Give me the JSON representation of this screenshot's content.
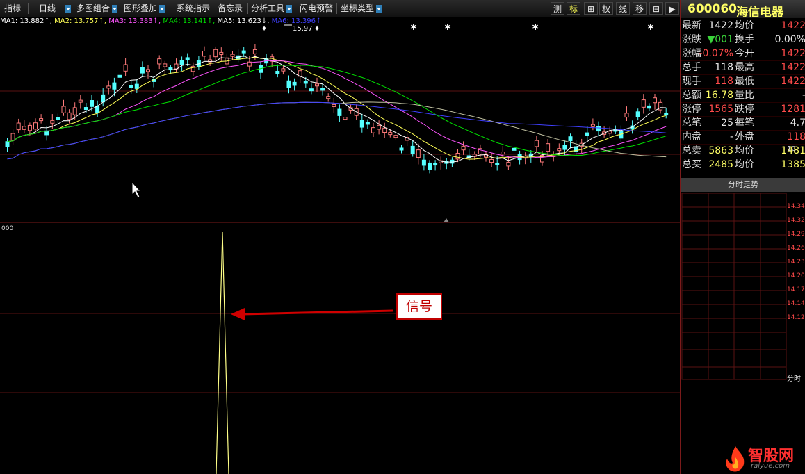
{
  "toolbar": {
    "items": [
      "指标",
      "日线",
      "多图组合",
      "图形叠加",
      "系统指示",
      "备忘录",
      "分析工具",
      "闪电预警",
      "坐标类型"
    ],
    "right_buttons": [
      "测",
      "标",
      "⊞",
      "权",
      "线",
      "移",
      "⊟",
      "▶"
    ]
  },
  "ma": {
    "ma1": "MA1: 13.882",
    "ma2": "MA2: 13.757",
    "ma3": "MA3: 13.383",
    "ma4": "MA4: 13.141",
    "ma5": "MA5: 13.623",
    "ma6": "MA6: 13.396",
    "peak": "15.97"
  },
  "indicator": {
    "label": "000"
  },
  "callout": {
    "text": "信号"
  },
  "stock": {
    "code": "600060",
    "name": "海信电器"
  },
  "quote": [
    {
      "l": "最新",
      "v": "1422",
      "l2": "均价",
      "v2": "1422"
    },
    {
      "l": "涨跌",
      "v": "▼001",
      "l2": "换手",
      "v2": "0.00%"
    },
    {
      "l": "涨幅",
      "v": "-0.07%",
      "l2": "今开",
      "v2": "1422"
    },
    {
      "l": "总手",
      "v": "118",
      "l2": "最高",
      "v2": "1422"
    },
    {
      "l": "现手",
      "v": "118",
      "l2": "最低",
      "v2": "1422"
    },
    {
      "l": "总额",
      "v": "16.78",
      "l2": "量比",
      "v2": "-"
    },
    {
      "l": "涨停",
      "v": "1565",
      "l2": "跌停",
      "v2": "1281"
    },
    {
      "l": "总笔",
      "v": "25",
      "l2": "每笔",
      "v2": "4.7"
    },
    {
      "l": "内盘",
      "v": "-",
      "l2": "外盘",
      "v2": "118"
    },
    {
      "l": "总卖",
      "v": "5863",
      "l2": "均价",
      "v2": "1481"
    },
    {
      "l": "总买",
      "v": "2485",
      "l2": "均价",
      "v2": "1385"
    }
  ],
  "ticker": {
    "tab": "分时走势",
    "axis": [
      "14.34",
      "14.32",
      "14.29",
      "14.26",
      "14.23",
      "14.20",
      "14.17",
      "14.14",
      "14.12"
    ],
    "vol": "10",
    "time": "分时"
  },
  "watermark": {
    "name": "智股网",
    "url": "raiyue.com"
  },
  "colors": {
    "up": "#ff7a7a",
    "down": "#54ffff",
    "ma1": "#ffffff",
    "ma2": "#ffff55",
    "ma3": "#ff55ff",
    "ma4": "#00e000",
    "ma5": "#4040ff",
    "ma6": "#c0c0a0"
  }
}
